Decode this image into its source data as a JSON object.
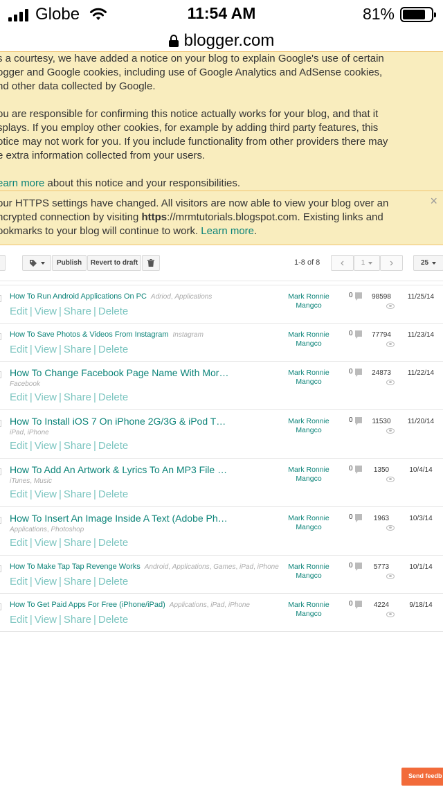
{
  "status_bar": {
    "carrier": "Globe",
    "time": "11:54 AM",
    "battery_percent": "81%",
    "battery_level": 0.81
  },
  "browser": {
    "url": "blogger.com"
  },
  "notice_cookies": {
    "paragraph1": [
      "s a courtesy, we have added a notice on your blog to explain Google's use of certain",
      "ogger and Google cookies, including use of Google Analytics and AdSense cookies,",
      "nd other data collected by Google."
    ],
    "paragraph2": [
      "ou are responsible for confirming this notice actually works for your blog, and that it",
      "splays. If you employ other cookies, for example by adding third party features, this",
      "otice may not work for you. If you include functionality from other providers there may",
      "e extra information collected from your users."
    ],
    "learn_more": "earn more",
    "learn_more_suffix": " about this notice and your responsibilities."
  },
  "notice_https": {
    "line1": "our HTTPS settings have changed. All visitors are now able to view your blog over an",
    "line2_prefix": "ncrypted connection by visiting ",
    "line2_bold": "https",
    "line2_suffix": "://mrmtutorials.blogspot.com. Existing links and",
    "line3_prefix": "ookmarks to your blog will continue to work. ",
    "line3_link": "Learn more",
    "line3_suffix": ".",
    "close": "×"
  },
  "toolbar": {
    "publish": "Publish",
    "revert": "Revert to draft",
    "count": "1-8 of 8",
    "prev": "‹",
    "page": "1",
    "next": "›",
    "page_size": "25"
  },
  "posts": [
    {
      "title": "How To Run Android Applications On PC",
      "labels": [
        "Adriod",
        "Applications"
      ],
      "author1": "Mark Ronnie",
      "author2": "Mangco",
      "comments": "0",
      "views": "98598",
      "date": "11/25/14"
    },
    {
      "title": "How To Save Photos & Videos From Instagram",
      "labels": [
        "Instagram"
      ],
      "author1": "Mark Ronnie",
      "author2": "Mangco",
      "comments": "0",
      "views": "77794",
      "date": "11/23/14"
    },
    {
      "title": "How To Change Facebook Page Name With Mor…",
      "labels": [
        "Facebook"
      ],
      "author1": "Mark Ronnie",
      "author2": "Mangco",
      "comments": "0",
      "views": "24873",
      "date": "11/22/14"
    },
    {
      "title": "How To Install iOS 7 On iPhone 2G/3G & iPod T…",
      "labels": [
        "iPad",
        "iPhone"
      ],
      "author1": "Mark Ronnie",
      "author2": "Mangco",
      "comments": "0",
      "views": "11530",
      "date": "11/20/14"
    },
    {
      "title": "How To Add An Artwork & Lyrics To An MP3 File …",
      "labels": [
        "iTunes",
        "Music"
      ],
      "author1": "Mark Ronnie",
      "author2": "Mangco",
      "comments": "0",
      "views": "1350",
      "date": "10/4/14"
    },
    {
      "title": "How To Insert An Image Inside A Text (Adobe Ph…",
      "labels": [
        "Applications",
        "Photoshop"
      ],
      "author1": "Mark Ronnie",
      "author2": "Mangco",
      "comments": "0",
      "views": "1963",
      "date": "10/3/14"
    },
    {
      "title": "How To Make Tap Tap Revenge Works",
      "labels": [
        "Android",
        "Applications",
        "Games",
        "iPad",
        "iPhone"
      ],
      "author1": "Mark Ronnie",
      "author2": "Mangco",
      "comments": "0",
      "views": "5773",
      "date": "10/1/14"
    },
    {
      "title": "How To Get Paid Apps For Free (iPhone/iPad)",
      "labels": [
        "Applications",
        "iPad",
        "iPhone"
      ],
      "author1": "Mark Ronnie",
      "author2": "Mangco",
      "comments": "0",
      "views": "4224",
      "date": "9/18/14"
    }
  ],
  "post_actions": {
    "edit": "Edit",
    "view": "View",
    "share": "Share",
    "delete": "Delete",
    "separator": "|"
  },
  "feedback": "Send feedb",
  "colors": {
    "link": "#0b8378",
    "notice_bg": "#f9edbe",
    "feedback_bg": "#f26b3a"
  }
}
